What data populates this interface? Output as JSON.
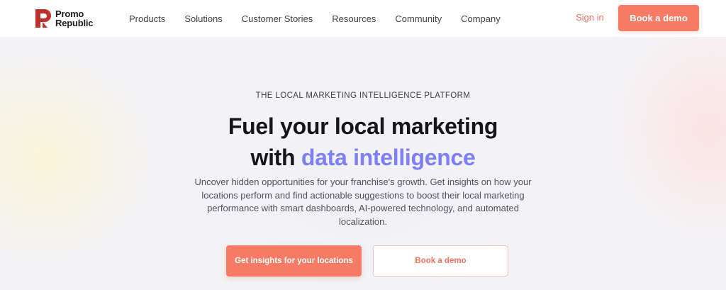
{
  "header": {
    "logo": {
      "line1": "Promo",
      "line2": "Republic",
      "icon": "promorepublic-logo-icon",
      "brand_color": "#c0302a"
    },
    "nav": [
      "Products",
      "Solutions",
      "Customer Stories",
      "Resources",
      "Community",
      "Company"
    ],
    "sign_in": "Sign in",
    "cta": "Book a demo"
  },
  "hero": {
    "eyebrow": "THE LOCAL MARKETING INTELLIGENCE PLATFORM",
    "headline_line1": "Fuel your local marketing",
    "headline_line2_prefix": "with ",
    "headline_line2_accent": "data intelligence",
    "subtext": "Uncover hidden opportunities for your franchise's growth. Get insights on how your locations perform and find actionable suggestions to boost their local marketing performance with smart dashboards, AI-powered technology, and automated localization.",
    "primary_button": "Get insights for your locations",
    "secondary_button": "Book a demo"
  },
  "colors": {
    "accent_coral": "#f87b66",
    "accent_purple": "#7c7ff6",
    "text_dark": "#15161a"
  }
}
